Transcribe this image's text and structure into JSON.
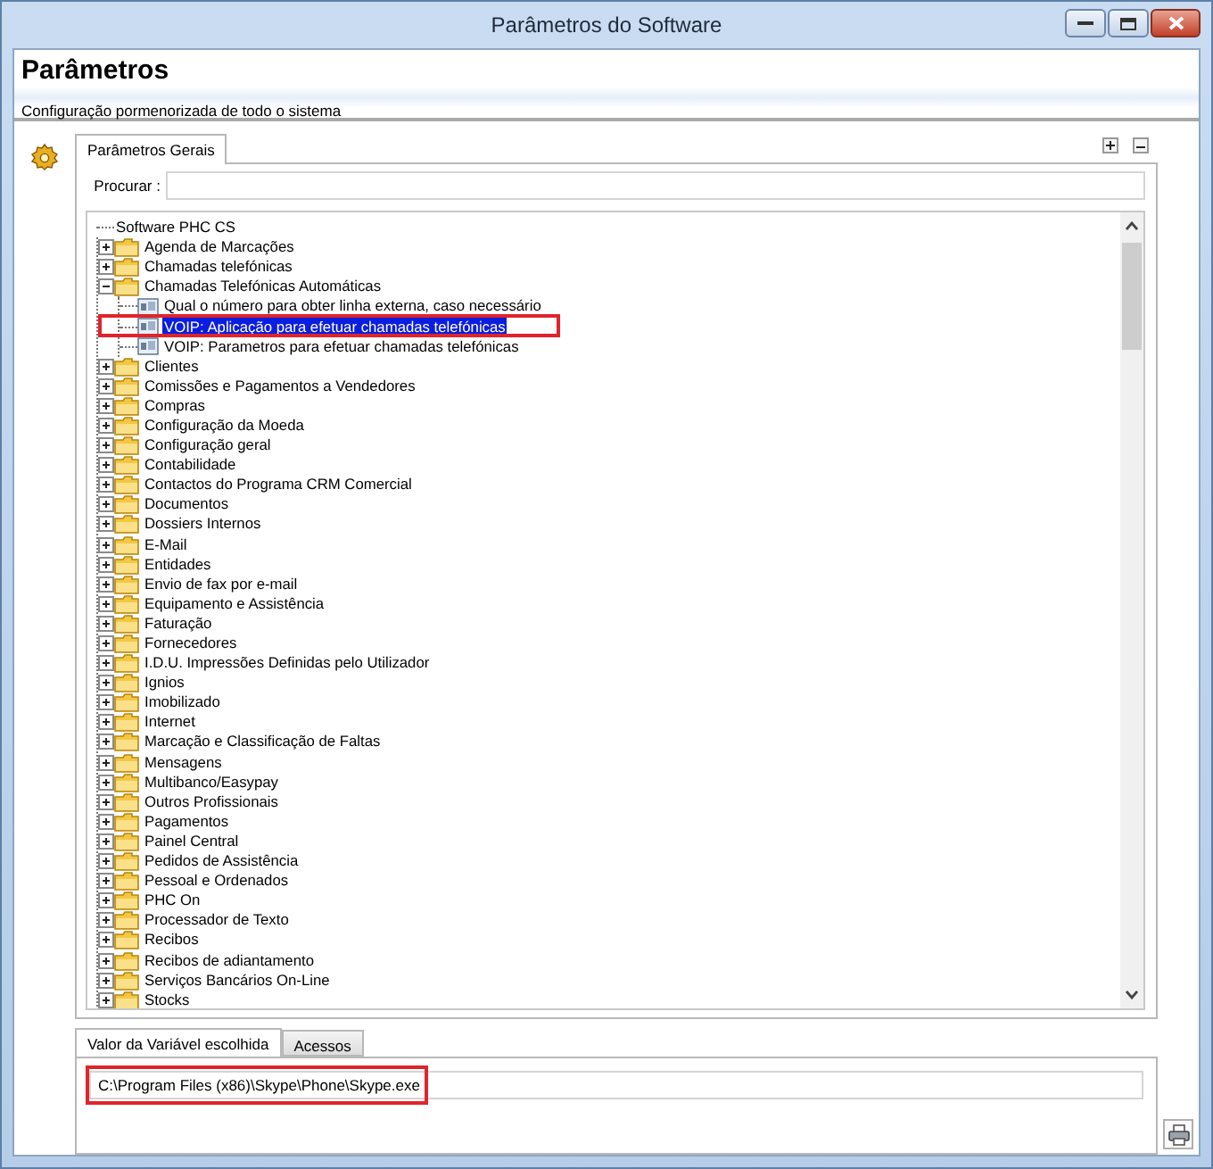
{
  "window": {
    "title": "Parâmetros do Software"
  },
  "header": {
    "title": "Parâmetros",
    "subtitle": "Configuração pormenorizada de todo o sistema"
  },
  "top_tabs": [
    {
      "label": "Parâmetros Gerais",
      "selected": true
    }
  ],
  "search": {
    "label": "Procurar :"
  },
  "tree": {
    "label": "Software PHC CS",
    "kind": "root",
    "selected": false,
    "children": [
      {
        "label": "Agenda de Marcações",
        "kind": "folder",
        "expanded": false,
        "selected": false
      },
      {
        "label": "Chamadas telefónicas",
        "kind": "folder",
        "expanded": false,
        "selected": false
      },
      {
        "label": "Chamadas Telefónicas Automáticas",
        "kind": "folder",
        "expanded": true,
        "selected": false,
        "children": [
          {
            "label": "Qual o número para obter linha externa, caso necessário",
            "kind": "setting",
            "selected": false
          },
          {
            "label": "VOIP: Aplicação para efetuar chamadas telefónicas",
            "kind": "setting",
            "selected": true,
            "highlighted": true
          },
          {
            "label": "VOIP: Parametros para efetuar chamadas telefónicas",
            "kind": "setting",
            "selected": false
          }
        ]
      },
      {
        "label": "Clientes",
        "kind": "folder",
        "expanded": false,
        "selected": false
      },
      {
        "label": "Comissões e Pagamentos a Vendedores",
        "kind": "folder",
        "expanded": false,
        "selected": false
      },
      {
        "label": "Compras",
        "kind": "folder",
        "expanded": false,
        "selected": false
      },
      {
        "label": "Configuração da Moeda",
        "kind": "folder",
        "expanded": false,
        "selected": false
      },
      {
        "label": "Configuração geral",
        "kind": "folder",
        "expanded": false,
        "selected": false
      },
      {
        "label": "Contabilidade",
        "kind": "folder",
        "expanded": false,
        "selected": false
      },
      {
        "label": "Contactos do Programa CRM Comercial",
        "kind": "folder",
        "expanded": false,
        "selected": false
      },
      {
        "label": "Documentos",
        "kind": "folder",
        "expanded": false,
        "selected": false
      },
      {
        "label": "Dossiers Internos",
        "kind": "folder",
        "expanded": false,
        "selected": false
      },
      {
        "label": "E-Mail",
        "kind": "folder",
        "expanded": false,
        "selected": false
      },
      {
        "label": "Entidades",
        "kind": "folder",
        "expanded": false,
        "selected": false
      },
      {
        "label": "Envio de fax por e-mail",
        "kind": "folder",
        "expanded": false,
        "selected": false
      },
      {
        "label": "Equipamento e Assistência",
        "kind": "folder",
        "expanded": false,
        "selected": false
      },
      {
        "label": "Faturação",
        "kind": "folder",
        "expanded": false,
        "selected": false
      },
      {
        "label": "Fornecedores",
        "kind": "folder",
        "expanded": false,
        "selected": false
      },
      {
        "label": "I.D.U. Impressões Definidas pelo Utilizador",
        "kind": "folder",
        "expanded": false,
        "selected": false
      },
      {
        "label": "Ignios",
        "kind": "folder",
        "expanded": false,
        "selected": false
      },
      {
        "label": "Imobilizado",
        "kind": "folder",
        "expanded": false,
        "selected": false
      },
      {
        "label": "Internet",
        "kind": "folder",
        "expanded": false,
        "selected": false
      },
      {
        "label": "Marcação e Classificação de Faltas",
        "kind": "folder",
        "expanded": false,
        "selected": false
      },
      {
        "label": "Mensagens",
        "kind": "folder",
        "expanded": false,
        "selected": false
      },
      {
        "label": "Multibanco/Easypay",
        "kind": "folder",
        "expanded": false,
        "selected": false
      },
      {
        "label": "Outros Profissionais",
        "kind": "folder",
        "expanded": false,
        "selected": false
      },
      {
        "label": "Pagamentos",
        "kind": "folder",
        "expanded": false,
        "selected": false
      },
      {
        "label": "Painel Central",
        "kind": "folder",
        "expanded": false,
        "selected": false
      },
      {
        "label": "Pedidos de Assistência",
        "kind": "folder",
        "expanded": false,
        "selected": false
      },
      {
        "label": "Pessoal e Ordenados",
        "kind": "folder",
        "expanded": false,
        "selected": false
      },
      {
        "label": "PHC On",
        "kind": "folder",
        "expanded": false,
        "selected": false
      },
      {
        "label": "Processador de Texto",
        "kind": "folder",
        "expanded": false,
        "selected": false
      },
      {
        "label": "Recibos",
        "kind": "folder",
        "expanded": false,
        "selected": false
      },
      {
        "label": "Recibos de adiantamento",
        "kind": "folder",
        "expanded": false,
        "selected": false
      },
      {
        "label": "Serviços Bancários On-Line",
        "kind": "folder",
        "expanded": false,
        "selected": false
      },
      {
        "label": "Stocks",
        "kind": "folder",
        "expanded": false,
        "selected": false
      }
    ]
  },
  "bottom_tabs": [
    {
      "label": "Valor da Variável escolhida",
      "selected": true
    },
    {
      "label": "Acessos",
      "selected": false
    }
  ],
  "value_field": {
    "value": "C:\\Program Files (x86)\\Skype\\Phone\\Skype.exe",
    "highlighted": true
  }
}
